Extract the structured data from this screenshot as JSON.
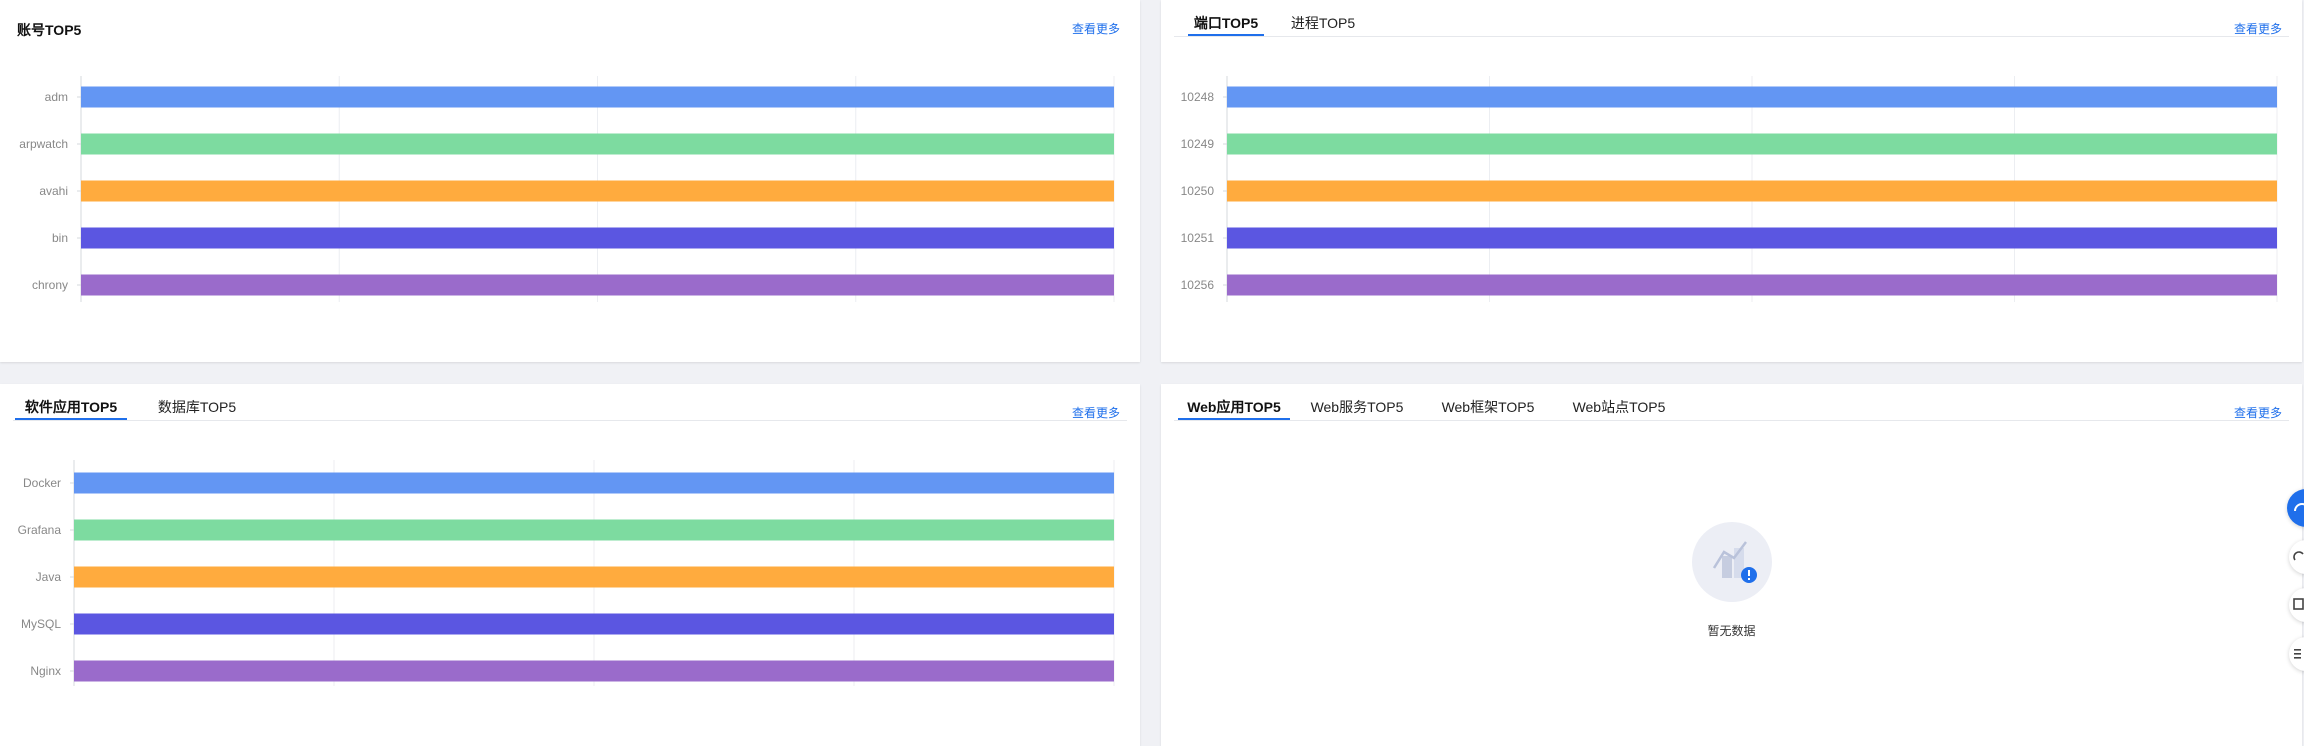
{
  "more_label": "查看更多",
  "account_panel": {
    "title": "账号TOP5",
    "chart_data": {
      "type": "bar",
      "orientation": "horizontal",
      "categories": [
        "adm",
        "arpwatch",
        "avahi",
        "bin",
        "chrony"
      ],
      "values": [
        1,
        1,
        1,
        1,
        1
      ],
      "xlim": [
        0,
        1
      ],
      "grid": true,
      "colors": [
        "#6396f3",
        "#7ddba0",
        "#ffab3e",
        "#5b56e1",
        "#9a6bcb"
      ]
    }
  },
  "port_panel": {
    "tabs": [
      {
        "label": "端口TOP5",
        "active": true
      },
      {
        "label": "进程TOP5",
        "active": false
      }
    ],
    "chart_data": {
      "type": "bar",
      "orientation": "horizontal",
      "categories": [
        "10248",
        "10249",
        "10250",
        "10251",
        "10256"
      ],
      "values": [
        1,
        1,
        1,
        1,
        1
      ],
      "xlim": [
        0,
        1
      ],
      "grid": true,
      "colors": [
        "#6396f3",
        "#7ddba0",
        "#ffab3e",
        "#5b56e1",
        "#9a6bcb"
      ]
    }
  },
  "software_panel": {
    "tabs": [
      {
        "label": "软件应用TOP5",
        "active": true
      },
      {
        "label": "数据库TOP5",
        "active": false
      }
    ],
    "chart_data": {
      "type": "bar",
      "orientation": "horizontal",
      "categories": [
        "Docker",
        "Grafana",
        "Java",
        "MySQL",
        "Nginx"
      ],
      "values": [
        1,
        1,
        1,
        1,
        1
      ],
      "xlim": [
        0,
        1
      ],
      "grid": true,
      "colors": [
        "#6396f3",
        "#7ddba0",
        "#ffab3e",
        "#5b56e1",
        "#9a6bcb"
      ]
    }
  },
  "web_panel": {
    "tabs": [
      {
        "label": "Web应用TOP5",
        "active": true
      },
      {
        "label": "Web服务TOP5",
        "active": false
      },
      {
        "label": "Web框架TOP5",
        "active": false
      },
      {
        "label": "Web站点TOP5",
        "active": false
      }
    ],
    "empty_text": "暂无数据"
  }
}
